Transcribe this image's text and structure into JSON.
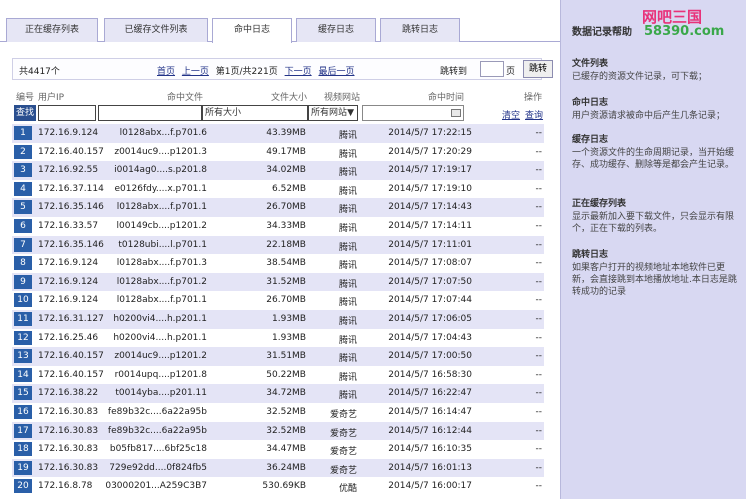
{
  "tabs": [
    {
      "label": "正在缓存列表",
      "active": false
    },
    {
      "label": "已缓存文件列表",
      "active": false
    },
    {
      "label": "命中日志",
      "active": true
    },
    {
      "label": "缓存日志",
      "active": false
    },
    {
      "label": "跳转日志",
      "active": false
    }
  ],
  "pager": {
    "total": "共4417个",
    "first": "首页",
    "prev": "上一页",
    "page_info": "第1页/共221页",
    "next": "下一页",
    "last": "最后一页",
    "jump_label": "跳转到",
    "jump_unit": "页",
    "jump_button": "跳转"
  },
  "columns": {
    "index": "编号",
    "ip": "用户IP",
    "file": "命中文件",
    "size": "文件大小",
    "site": "视频网站",
    "time": "命中时间",
    "op": "操作"
  },
  "filters": {
    "query_button": "查找",
    "size_value": "所有大小",
    "site_value": "所有网站",
    "clear": "清空",
    "search": "查询"
  },
  "rows": [
    {
      "n": "1",
      "ip": "172.16.9.124",
      "file": "l0128abx...f.p701.6",
      "size": "43.39MB",
      "site": "腾讯",
      "time": "2014/5/7 17:22:15",
      "op": "--"
    },
    {
      "n": "2",
      "ip": "172.16.40.157",
      "file": "z0014uc9....p1201.3",
      "size": "49.17MB",
      "site": "腾讯",
      "time": "2014/5/7 17:20:29",
      "op": "--"
    },
    {
      "n": "3",
      "ip": "172.16.92.55",
      "file": "i0014ag0....s.p201.8",
      "size": "34.02MB",
      "site": "腾讯",
      "time": "2014/5/7 17:19:17",
      "op": "--"
    },
    {
      "n": "4",
      "ip": "172.16.37.114",
      "file": "e0126fdy....x.p701.1",
      "size": "6.52MB",
      "site": "腾讯",
      "time": "2014/5/7 17:19:10",
      "op": "--"
    },
    {
      "n": "5",
      "ip": "172.16.35.146",
      "file": "l0128abx....f.p701.1",
      "size": "26.70MB",
      "site": "腾讯",
      "time": "2014/5/7 17:14:43",
      "op": "--"
    },
    {
      "n": "6",
      "ip": "172.16.33.57",
      "file": "l00149cb....p1201.2",
      "size": "34.33MB",
      "site": "腾讯",
      "time": "2014/5/7 17:14:11",
      "op": "--"
    },
    {
      "n": "7",
      "ip": "172.16.35.146",
      "file": "t0128ubi....l.p701.1",
      "size": "22.18MB",
      "site": "腾讯",
      "time": "2014/5/7 17:11:01",
      "op": "--"
    },
    {
      "n": "8",
      "ip": "172.16.9.124",
      "file": "l0128abx....f.p701.3",
      "size": "38.54MB",
      "site": "腾讯",
      "time": "2014/5/7 17:08:07",
      "op": "--"
    },
    {
      "n": "9",
      "ip": "172.16.9.124",
      "file": "l0128abx....f.p701.2",
      "size": "31.52MB",
      "site": "腾讯",
      "time": "2014/5/7 17:07:50",
      "op": "--"
    },
    {
      "n": "10",
      "ip": "172.16.9.124",
      "file": "l0128abx....f.p701.1",
      "size": "26.70MB",
      "site": "腾讯",
      "time": "2014/5/7 17:07:44",
      "op": "--"
    },
    {
      "n": "11",
      "ip": "172.16.31.127",
      "file": "h0200vi4....h.p201.1",
      "size": "1.93MB",
      "site": "腾讯",
      "time": "2014/5/7 17:06:05",
      "op": "--"
    },
    {
      "n": "12",
      "ip": "172.16.25.46",
      "file": "h0200vi4....h.p201.1",
      "size": "1.93MB",
      "site": "腾讯",
      "time": "2014/5/7 17:04:43",
      "op": "--"
    },
    {
      "n": "13",
      "ip": "172.16.40.157",
      "file": "z0014uc9....p1201.2",
      "size": "31.51MB",
      "site": "腾讯",
      "time": "2014/5/7 17:00:50",
      "op": "--"
    },
    {
      "n": "14",
      "ip": "172.16.40.157",
      "file": "r0014upq....p1201.8",
      "size": "50.22MB",
      "site": "腾讯",
      "time": "2014/5/7 16:58:30",
      "op": "--"
    },
    {
      "n": "15",
      "ip": "172.16.38.22",
      "file": "t0014yba....p201.11",
      "size": "34.72MB",
      "site": "腾讯",
      "time": "2014/5/7 16:22:47",
      "op": "--"
    },
    {
      "n": "16",
      "ip": "172.16.30.83",
      "file": "fe89b32c....6a22a95b",
      "size": "32.52MB",
      "site": "爱奇艺",
      "time": "2014/5/7 16:14:47",
      "op": "--"
    },
    {
      "n": "17",
      "ip": "172.16.30.83",
      "file": "fe89b32c....6a22a95b",
      "size": "32.52MB",
      "site": "爱奇艺",
      "time": "2014/5/7 16:12:44",
      "op": "--"
    },
    {
      "n": "18",
      "ip": "172.16.30.83",
      "file": "b05fb817....6bf25c18",
      "size": "34.47MB",
      "site": "爱奇艺",
      "time": "2014/5/7 16:10:35",
      "op": "--"
    },
    {
      "n": "19",
      "ip": "172.16.30.83",
      "file": "729e92dd....0f824fb5",
      "size": "36.24MB",
      "site": "爱奇艺",
      "time": "2014/5/7 16:01:13",
      "op": "--"
    },
    {
      "n": "20",
      "ip": "172.16.8.78",
      "file": "03000201...A259C3B7",
      "size": "530.69KB",
      "site": "优酷",
      "time": "2014/5/7 16:00:17",
      "op": "--"
    }
  ],
  "sidebar": {
    "title": "数据记录帮助",
    "logo_text": "网吧三国",
    "logo_sub": "58390.com",
    "sections": [
      {
        "title": "文件列表",
        "desc": "已缓存的资源文件记录，可下载；"
      },
      {
        "title": "命中日志",
        "desc": "用户资源请求被命中后产生几条记录；"
      },
      {
        "title": "缓存日志",
        "desc": "一个资源文件的生命周期记录，当开始缓存、成功缓存、删除等是都会产生记录。"
      },
      {
        "title": "正在缓存列表",
        "desc": "显示最新加入要下载文件，只会显示有限个，正在下载的列表。"
      },
      {
        "title": "跳转日志",
        "desc": "如果客户打开的视频地址本地软件已更新，会直接跳到本地播放地址.本日志是跳转成功的记录"
      }
    ]
  },
  "colors": {
    "index_badge": "#2a5fa8",
    "row_alt": "#e4e4f6",
    "sidebar_bg": "#d8d8f2",
    "logo_pink": "#e8327a",
    "logo_green": "#3aa84a"
  }
}
